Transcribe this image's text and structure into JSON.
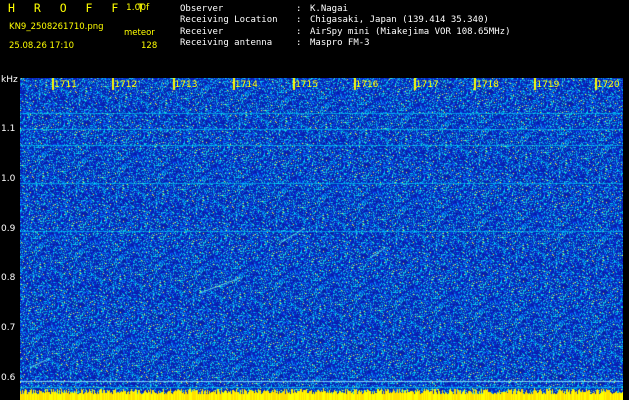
{
  "header": {
    "app_title": "H R O F F T",
    "version": "1.00f",
    "file_name": "KN9_2508261710.png",
    "meteor_label": "meteor",
    "timestamp": "25.08.26 17:10",
    "count": "128"
  },
  "info": [
    {
      "label": "Observer",
      "value": "K.Nagai"
    },
    {
      "label": "Receiving Location",
      "value": "Chigasaki, Japan (139.414 35.340)"
    },
    {
      "label": "Receiver",
      "value": "AirSpy mini (Miakejima VOR 108.65MHz)"
    },
    {
      "label": "Receiving antenna",
      "value": "Maspro FM-3"
    }
  ],
  "chart_data": {
    "type": "heatmap",
    "ylabel": "kHz",
    "y_ticks": [
      "1.1",
      "1.0",
      "0.9",
      "0.8",
      "0.7",
      "0.6"
    ],
    "time_labels": [
      "1711",
      "1712",
      "1713",
      "1714",
      "1715",
      "1716",
      "1717",
      "1718",
      "1719",
      "1720"
    ],
    "ylim": [
      0.58,
      1.18
    ],
    "colors": {
      "background": "#0a1fb0",
      "noise_high": "#00e0ff",
      "noise_peak": "#ffff00",
      "marker": "#ffff00"
    }
  }
}
